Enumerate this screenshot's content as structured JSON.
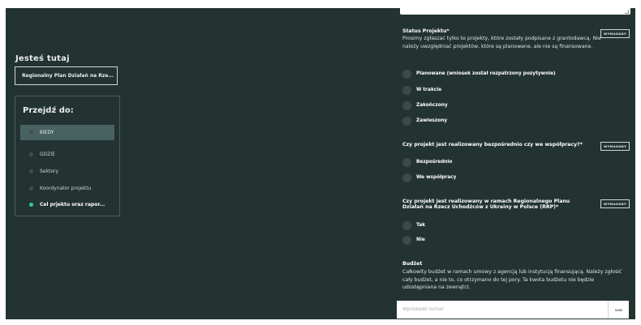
{
  "nav": {
    "here_label": "Jesteś tutaj",
    "current_page": "Regionalny Plan Działań na Rze...",
    "goto_label": "Przejdź do:",
    "items": [
      {
        "label": "KIEDY"
      },
      {
        "label": "GDZIE"
      },
      {
        "label": "Sektory"
      },
      {
        "label": "Koordynator projektu"
      },
      {
        "label": "Cel prjektu oraz rapor..."
      }
    ]
  },
  "form": {
    "required_label": "WYMAGANY",
    "status": {
      "title": "Status Projektu*",
      "description": "Prosimy zgłaszać tylko te projekty, które zostały podpisane z grantodawcą. Nie należy uwzględniać projektów, które są planowane, ale nie są finansowane.",
      "options": [
        "Planowane (wniosek został rozpatrzony pozytywnie)",
        "W trakcie",
        "Zakończony",
        "Zawieszony"
      ]
    },
    "direct": {
      "title": "Czy projekt jest realizowany bezpośrednio czy we współpracy?*",
      "options": [
        "Bezpośrednio",
        "We współpracy"
      ]
    },
    "rrp": {
      "title_line1": "Czy projekt jest realizowany w ramach Regionalnego Planu",
      "title_line2": "Działań na Rzecz Uchodźców z Ukrainy w Polsce (RRP)*",
      "options": [
        "Tak",
        "Nie"
      ]
    },
    "budget": {
      "title": "Budżet",
      "description": "Całkowity budżet w ramach umowy z agencją lub instytucją finansującą. Należy zgłosić cały budżet, a nie to, co otrzymano do tej pory. Ta kwota budżetu nie będzie udostępniana na zewnątrz.",
      "placeholder": "Wprowadź numer",
      "currency": "USD"
    }
  }
}
